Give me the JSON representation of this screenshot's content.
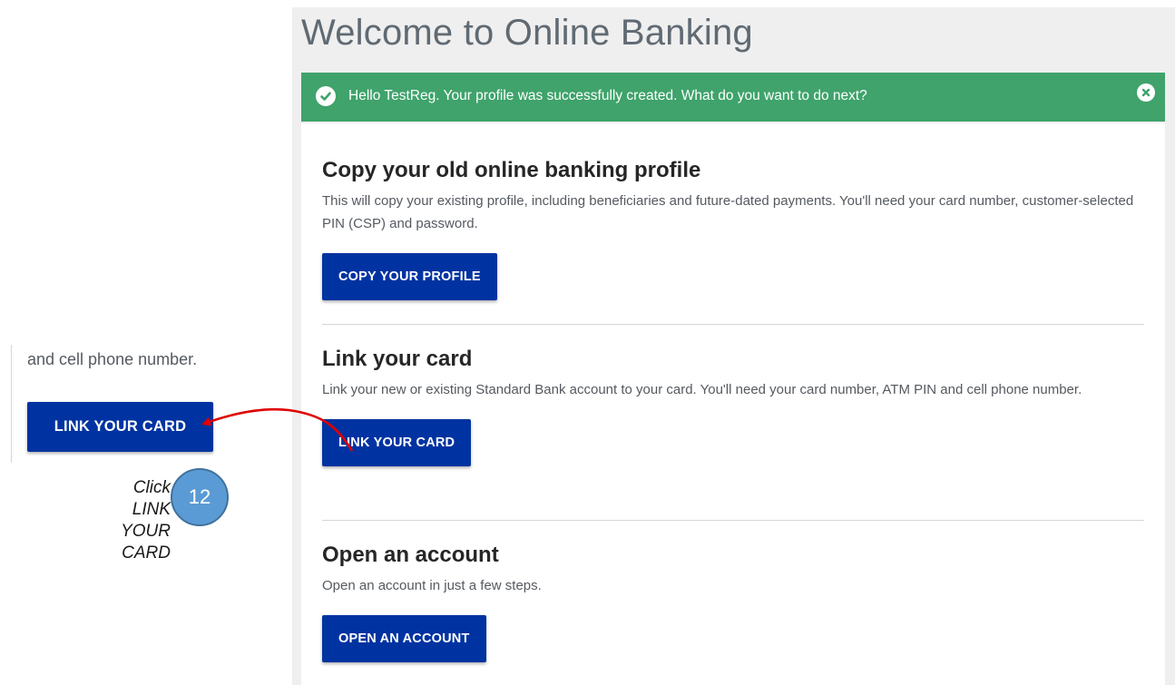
{
  "page": {
    "title": "Welcome to Online Banking"
  },
  "alert": {
    "message": "Hello TestReg. Your profile was successfully created. What do you want to do next?",
    "icon": "check-circle-icon",
    "close_icon": "close-circle-icon",
    "color": "#3fa36b"
  },
  "options": [
    {
      "title": "Copy your old online banking profile",
      "description": "This will copy your existing profile, including beneficiaries and future-dated payments. You'll need your card number, customer-selected PIN (CSP) and password.",
      "button_label": "COPY YOUR PROFILE"
    },
    {
      "title": "Link your card",
      "description": "Link your new or existing Standard Bank account to your card. You'll need your card number, ATM PIN and cell phone number.",
      "button_label": "LINK YOUR CARD"
    },
    {
      "title": "Open an account",
      "description": "Open an account in just a few steps.",
      "button_label": "OPEN AN ACCOUNT"
    }
  ],
  "zoom_inset": {
    "text": "and cell phone number.",
    "button_label": "LINK YOUR CARD"
  },
  "annotation": {
    "instruction": "Click LINK YOUR CARD",
    "step_number": "12",
    "arrow_color": "#e00000",
    "badge_color": "#5b9bd5"
  },
  "colors": {
    "button_blue": "#0033a1",
    "success_green": "#3fa36b"
  }
}
